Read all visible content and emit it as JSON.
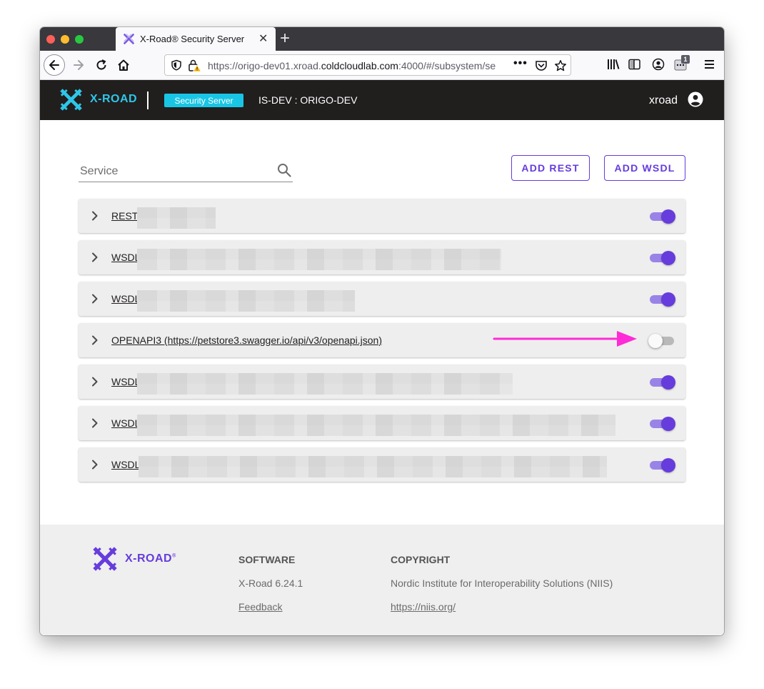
{
  "browser": {
    "tab_title": "X-Road® Security Server",
    "url_prefix": "https://origo-dev01.xroad.",
    "url_domain": "coldcloudlab.com",
    "url_suffix": ":4000/#/subsystem/se",
    "extensions_badge": "1"
  },
  "header": {
    "brand": "X-ROAD",
    "badge": "Security Server",
    "server_id": "IS-DEV : ORIGO-DEV",
    "username": "xroad"
  },
  "toolbar": {
    "search_placeholder": "Service",
    "add_rest_label": "ADD REST",
    "add_wsdl_label": "ADD WSDL"
  },
  "services": [
    {
      "name": "REST",
      "enabled": true
    },
    {
      "name": "WSDL",
      "enabled": true
    },
    {
      "name": "WSDL",
      "enabled": true
    },
    {
      "name": "OPENAPI3 (https://petstore3.swagger.io/api/v3/openapi.json)",
      "enabled": false
    },
    {
      "name": "WSDL",
      "enabled": true
    },
    {
      "name": "WSDL",
      "enabled": true
    },
    {
      "name": "WSDL",
      "enabled": true
    }
  ],
  "footer": {
    "brand": "X-ROAD",
    "brand_mark": "®",
    "software_heading": "SOFTWARE",
    "version": "X-Road 6.24.1",
    "feedback": "Feedback",
    "copyright_heading": "COPYRIGHT",
    "org": "Nordic Institute for Interoperability Solutions (NIIS)",
    "org_url": "https://niis.org/"
  },
  "colors": {
    "accent": "#663cdc",
    "header_bg": "#211e1e",
    "brand_cyan": "#2ec7e7",
    "annotation_arrow": "#ff2bd6"
  }
}
